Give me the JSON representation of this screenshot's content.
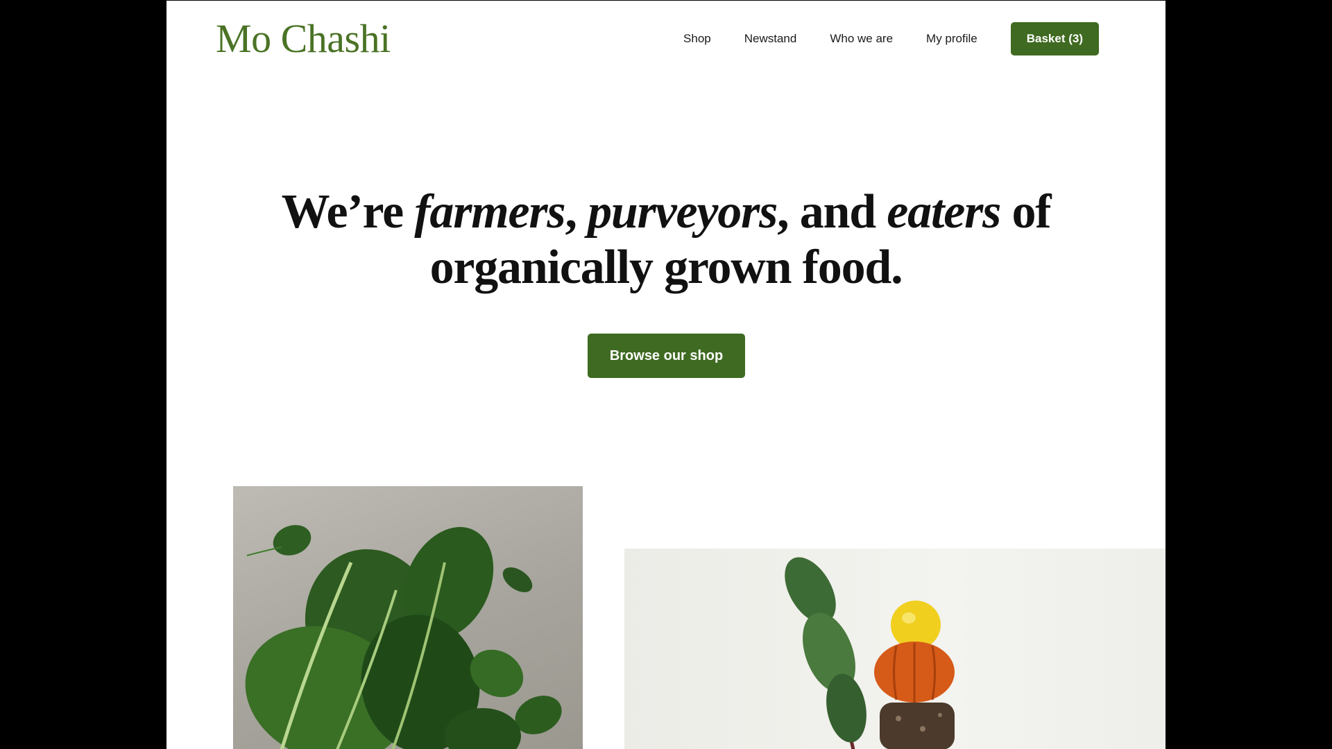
{
  "brand": {
    "name": "Mo Chashi",
    "color": "#4a7325"
  },
  "nav": {
    "items": [
      {
        "label": "Shop"
      },
      {
        "label": "Newstand"
      },
      {
        "label": "Who we are"
      },
      {
        "label": "My profile"
      }
    ],
    "basket_label": "Basket (3)"
  },
  "hero": {
    "part1": "We’re ",
    "em1": "farmers",
    "part2": ", ",
    "em2": "purveyors",
    "part3": ", and ",
    "em3": "eaters",
    "part4": " of",
    "line2": "organically grown food.",
    "cta_label": "Browse our shop"
  },
  "colors": {
    "accent": "#3f6a21",
    "page_bg": "#ffffff",
    "outer_bg": "#000000"
  },
  "images": [
    {
      "name": "leafy-greens-photo"
    },
    {
      "name": "stacked-produce-photo"
    }
  ]
}
